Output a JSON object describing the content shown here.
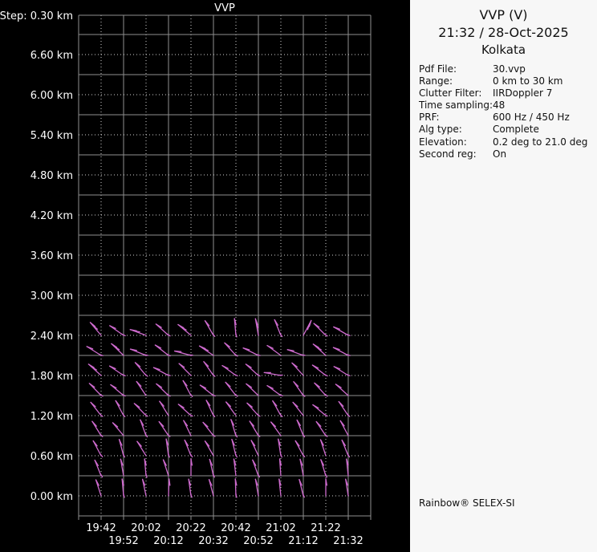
{
  "colors": {
    "plot_bg": "#000000",
    "panel_bg": "#f7f7f7",
    "grid_solid": "#8f8f8f",
    "grid_dotted": "#d2d2d2",
    "axis_text": "#ffffff",
    "barb": "#ce6bce",
    "panel_text": "#111111"
  },
  "chart": {
    "type": "wind-barb-time-height",
    "title": "VVP",
    "step_label": "Step: 0.30 km",
    "y_axis": {
      "labels": [
        "6.60 km",
        "6.00 km",
        "5.40 km",
        "4.80 km",
        "4.20 km",
        "3.60 km",
        "3.00 km",
        "2.40 km",
        "1.80 km",
        "1.20 km",
        "0.60 km",
        "0.00 km"
      ]
    },
    "x_axis": {
      "row1": [
        "19:42",
        "20:02",
        "20:22",
        "20:42",
        "21:02",
        "21:22"
      ],
      "row2": [
        "19:52",
        "20:12",
        "20:32",
        "20:52",
        "21:12",
        "21:32"
      ]
    },
    "barbs": {
      "times": [
        "19:42",
        "19:52",
        "20:02",
        "20:12",
        "20:22",
        "20:32",
        "20:42",
        "20:52",
        "21:02",
        "21:12",
        "21:22",
        "21:32"
      ],
      "heights_km": [
        0.0,
        0.3,
        0.6,
        0.9,
        1.2,
        1.5,
        1.8,
        2.1,
        2.4
      ],
      "angles_deg": [
        [
          108,
          95,
          102,
          88,
          98,
          105,
          92,
          100,
          96,
          104,
          90,
          99
        ],
        [
          112,
          100,
          95,
          108,
          90,
          103,
          97,
          110,
          94,
          101,
          107,
          96
        ],
        [
          118,
          105,
          122,
          98,
          112,
          120,
          104,
          115,
          99,
          118,
          108,
          112
        ],
        [
          122,
          130,
          110,
          124,
          116,
          128,
          107,
          121,
          126,
          112,
          124,
          118
        ],
        [
          128,
          118,
          134,
          122,
          138,
          115,
          126,
          132,
          119,
          128,
          140,
          124
        ],
        [
          134,
          140,
          124,
          136,
          118,
          142,
          128,
          136,
          144,
          125,
          132,
          138
        ],
        [
          138,
          146,
          130,
          152,
          135,
          125,
          144,
          138,
          170,
          132,
          142,
          148
        ],
        [
          148,
          136,
          158,
          142,
          165,
          146,
          132,
          154,
          144,
          160,
          138,
          152
        ],
        [
          130,
          145,
          160,
          138,
          140,
          120,
          95,
          100,
          112,
          62,
          135,
          150
        ]
      ],
      "speed_kt": [
        [
          10,
          15,
          10,
          10,
          15,
          10,
          15,
          10,
          10,
          15,
          10,
          10
        ],
        [
          15,
          10,
          15,
          10,
          10,
          15,
          10,
          15,
          10,
          10,
          15,
          10
        ],
        [
          15,
          15,
          10,
          15,
          15,
          10,
          15,
          10,
          15,
          15,
          10,
          15
        ],
        [
          15,
          10,
          15,
          15,
          10,
          15,
          15,
          15,
          10,
          15,
          15,
          10
        ],
        [
          15,
          15,
          15,
          10,
          15,
          15,
          10,
          15,
          15,
          10,
          15,
          15
        ],
        [
          15,
          15,
          10,
          15,
          15,
          15,
          15,
          10,
          15,
          15,
          15,
          10
        ],
        [
          20,
          15,
          15,
          15,
          10,
          15,
          15,
          15,
          15,
          10,
          15,
          15
        ],
        [
          15,
          20,
          15,
          15,
          15,
          20,
          15,
          15,
          10,
          15,
          20,
          15
        ],
        [
          20,
          15,
          20,
          15,
          20,
          15,
          15,
          20,
          15,
          20,
          15,
          15
        ]
      ]
    }
  },
  "info_panel": {
    "title": "VVP (V)",
    "datetime": "21:32 / 28-Oct-2025",
    "site": "Kolkata",
    "fields": [
      {
        "label": "Pdf File:",
        "value": "30.vvp"
      },
      {
        "label": "Range:",
        "value": "0 km to 30 km"
      },
      {
        "label": "Clutter Filter:",
        "value": "IIRDoppler 7"
      },
      {
        "label": "Time sampling:",
        "value": "48"
      },
      {
        "label": "PRF:",
        "value": "600 Hz / 450 Hz"
      },
      {
        "label": "Alg type:",
        "value": "Complete"
      },
      {
        "label": "Elevation:",
        "value": "0.2 deg to 21.0 deg"
      },
      {
        "label": "Second reg:",
        "value": "On"
      }
    ],
    "footer": "Rainbow® SELEX-SI"
  }
}
